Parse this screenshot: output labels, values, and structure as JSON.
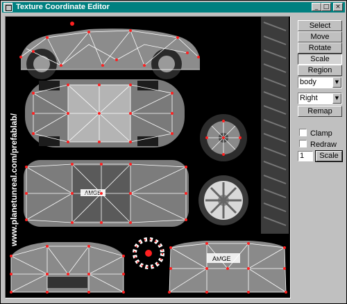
{
  "window": {
    "title": "Texture Coordinate Editor",
    "buttons": {
      "minimize": "_",
      "maximize": "□",
      "close": "×"
    }
  },
  "canvas": {
    "watermark": "www.planetunreal.com/prefablab/",
    "plate_text_rear": "AMGE",
    "plate_text_top": "AMGE",
    "background": "#000000",
    "vertex_color": "#ff2020",
    "mesh_color": "#ffffff"
  },
  "toolbar": {
    "select": "Select",
    "move": "Move",
    "rotate": "Rotate",
    "scale": "Scale",
    "region": "Region",
    "remap": "Remap",
    "scale_small": "Scale"
  },
  "selects": {
    "part": "body",
    "side": "Right"
  },
  "options": {
    "clamp": "Clamp",
    "redraw": "Redraw",
    "scale_value": "1"
  }
}
